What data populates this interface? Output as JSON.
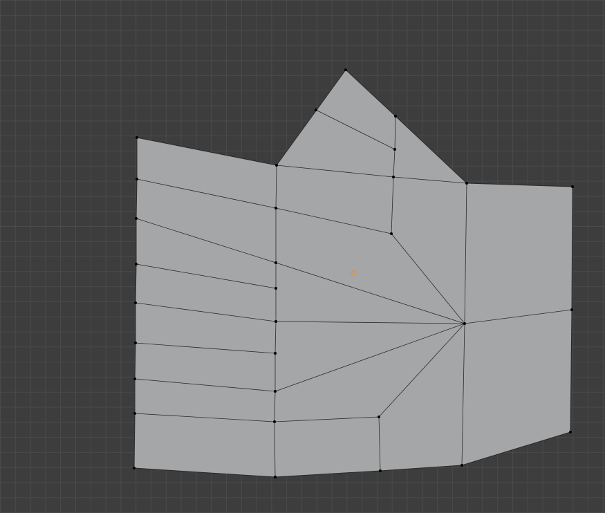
{
  "editor": {
    "mode": "edit-mode",
    "view": "top-orthographic"
  },
  "colors": {
    "background": "#3d3d3d",
    "grid_line": "#4a4a4a",
    "face_fill": "#a5a6a7",
    "edge": "#2a2a2a",
    "vertex": "#000000",
    "origin": "#ff8a1f"
  },
  "icons": {
    "origin": "object-origin-icon"
  }
}
